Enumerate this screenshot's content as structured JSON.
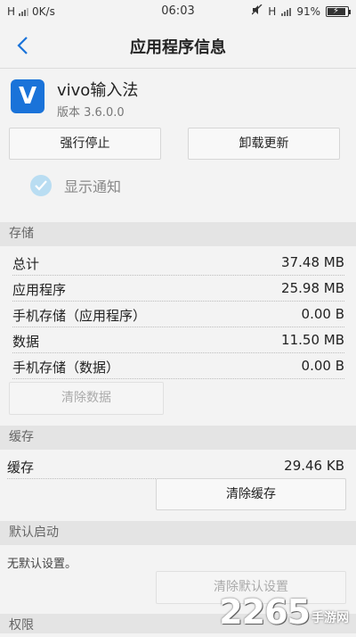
{
  "status_bar": {
    "network": "H",
    "speed": "0K/s",
    "time": "06:03",
    "sim_indicator": "H",
    "battery": "91%",
    "battery_level": 0.91
  },
  "header": {
    "title": "应用程序信息"
  },
  "app": {
    "name": "vivo输入法",
    "version": "版本 3.6.0.0",
    "icon_letter": "V"
  },
  "actions": {
    "force_stop": "强行停止",
    "uninstall_update": "卸载更新"
  },
  "notification": {
    "label": "显示通知",
    "checked": true
  },
  "storage": {
    "header": "存储",
    "rows": [
      {
        "label": "总计",
        "value": "37.48 MB"
      },
      {
        "label": "应用程序",
        "value": "25.98 MB"
      },
      {
        "label": "手机存储（应用程序）",
        "value": "0.00 B"
      },
      {
        "label": "数据",
        "value": "11.50 MB"
      },
      {
        "label": "手机存储（数据）",
        "value": "0.00 B"
      }
    ],
    "clear_data": "清除数据"
  },
  "cache": {
    "header": "缓存",
    "row": {
      "label": "缓存",
      "value": "29.46 KB"
    },
    "clear_cache": "清除缓存"
  },
  "default_launch": {
    "header": "默认启动",
    "text": "无默认设置。",
    "clear_defaults": "清除默认设置"
  },
  "permissions": {
    "header": "权限"
  },
  "watermark": {
    "number": "2265",
    "suffix": "手游网"
  },
  "colors": {
    "accent": "#1a73d9",
    "check": "#b9ddf2"
  }
}
